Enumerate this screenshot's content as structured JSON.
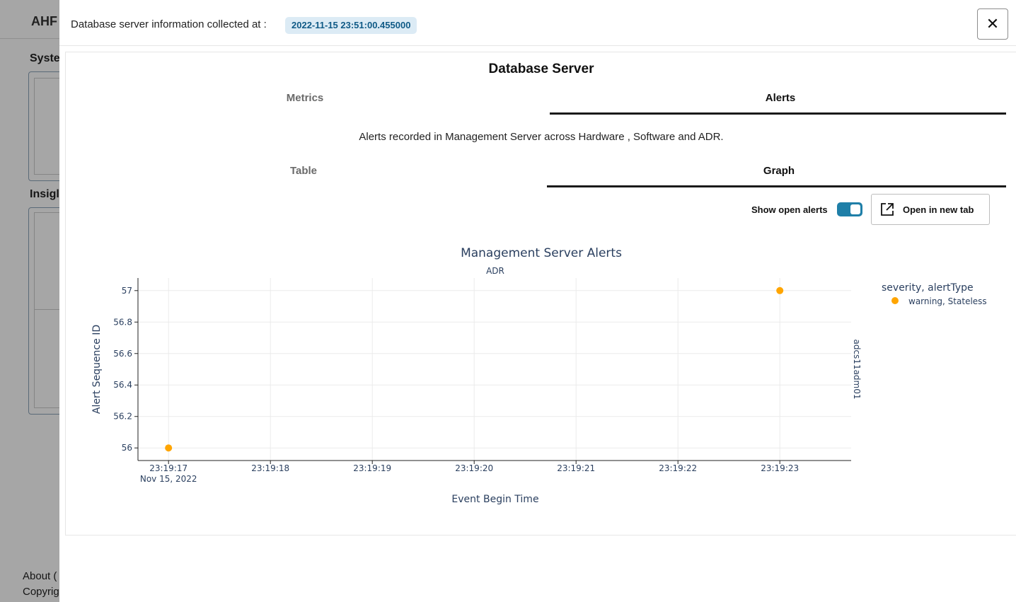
{
  "background": {
    "app_title": "AHF",
    "section_system": "Syste",
    "section_insights": "Insigl",
    "footer_about": "About (",
    "footer_copyright": "Copyrig"
  },
  "modal": {
    "collected_label": "Database server information collected at :",
    "collected_timestamp": "2022-11-15 23:51:00.455000",
    "close_icon": "close-icon",
    "close_glyph": "✕"
  },
  "panel": {
    "title": "Database Server",
    "tabs": [
      {
        "label": "Metrics",
        "active": false
      },
      {
        "label": "Alerts",
        "active": true
      }
    ],
    "description": "Alerts recorded in Management Server across Hardware , Software and ADR.",
    "subtabs": [
      {
        "label": "Table",
        "active": false
      },
      {
        "label": "Graph",
        "active": true
      }
    ],
    "toggle_label": "Show open alerts",
    "toggle_on": true,
    "open_button_label": "Open in new tab",
    "open_button_icon": "external-link-icon"
  },
  "chart_data": {
    "type": "scatter",
    "title": "Management Server Alerts",
    "facet_col_label": "ADR",
    "facet_row_label": "adcs11adm01",
    "xlabel": "Event Begin Time",
    "ylabel": "Alert Sequence ID",
    "x_ticks": [
      "23:19:17",
      "23:19:18",
      "23:19:19",
      "23:19:20",
      "23:19:21",
      "23:19:22",
      "23:19:23"
    ],
    "x_tick_sub": "Nov 15, 2022",
    "y_ticks": [
      "56",
      "56.2",
      "56.4",
      "56.6",
      "56.8",
      "57"
    ],
    "ylim": [
      55.92,
      57.08
    ],
    "xlim": [
      "23:19:16.7",
      "23:19:23.7"
    ],
    "grid": true,
    "legend_title": "severity, alertType",
    "legend_placement": "top-right",
    "series": [
      {
        "name": "warning, Stateless",
        "color": "#ffa500",
        "points": [
          {
            "x": "2022-11-15 23:19:17",
            "y": 56
          },
          {
            "x": "2022-11-15 23:19:23",
            "y": 57
          }
        ]
      }
    ]
  }
}
